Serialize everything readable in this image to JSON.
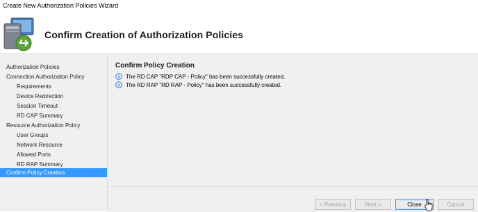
{
  "window": {
    "title": "Create New Authorization Policies Wizard"
  },
  "header": {
    "title": "Confirm Creation of Authorization Policies",
    "icon": "computer-network-icon"
  },
  "sidebar": {
    "items": [
      {
        "label": "Authorization Policies",
        "level": 0,
        "selected": false
      },
      {
        "label": "Connection Authorization Policy",
        "level": 0,
        "selected": false
      },
      {
        "label": "Requirements",
        "level": 1,
        "selected": false
      },
      {
        "label": "Device Redirection",
        "level": 1,
        "selected": false
      },
      {
        "label": "Session Timeout",
        "level": 1,
        "selected": false
      },
      {
        "label": "RD CAP Summary",
        "level": 1,
        "selected": false
      },
      {
        "label": "Resource Authorization Policy",
        "level": 0,
        "selected": false
      },
      {
        "label": "User Groups",
        "level": 1,
        "selected": false
      },
      {
        "label": "Network Resource",
        "level": 1,
        "selected": false
      },
      {
        "label": "Allowed Ports",
        "level": 1,
        "selected": false
      },
      {
        "label": "RD RAP Summary",
        "level": 1,
        "selected": false
      },
      {
        "label": "Confirm Policy Creation",
        "level": 0,
        "selected": true
      }
    ]
  },
  "main": {
    "title": "Confirm Policy Creation",
    "messages": [
      {
        "icon": "info-icon",
        "text": "The RD CAP \"RDP CAP - Policy\" has been successfully created."
      },
      {
        "icon": "info-icon",
        "text": "The RD RAP \"RD RAP - Policy\" has been successfully created."
      }
    ]
  },
  "buttons": {
    "previous": "< Previous",
    "next": "Next >",
    "close": "Close",
    "cancel": "Cancel"
  },
  "colors": {
    "selection": "#3399ff",
    "info": "#2a6fcf"
  }
}
